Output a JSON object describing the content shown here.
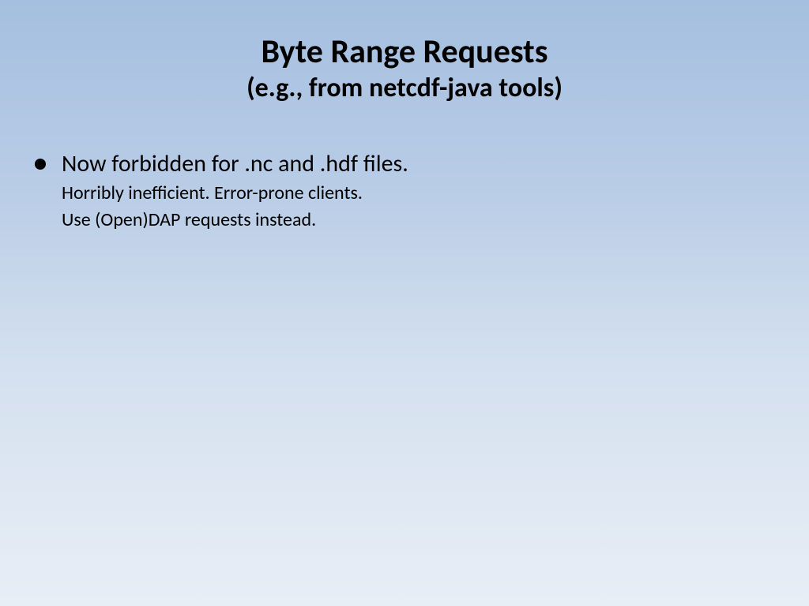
{
  "slide": {
    "title": "Byte Range Requests",
    "subtitle": "(e.g., from netcdf-java tools)",
    "bullets": [
      {
        "main": "Now forbidden for .nc and .hdf files.",
        "sub1": "Horribly inefficient. Error-prone clients.",
        "sub2": "Use (Open)DAP requests instead."
      }
    ]
  }
}
